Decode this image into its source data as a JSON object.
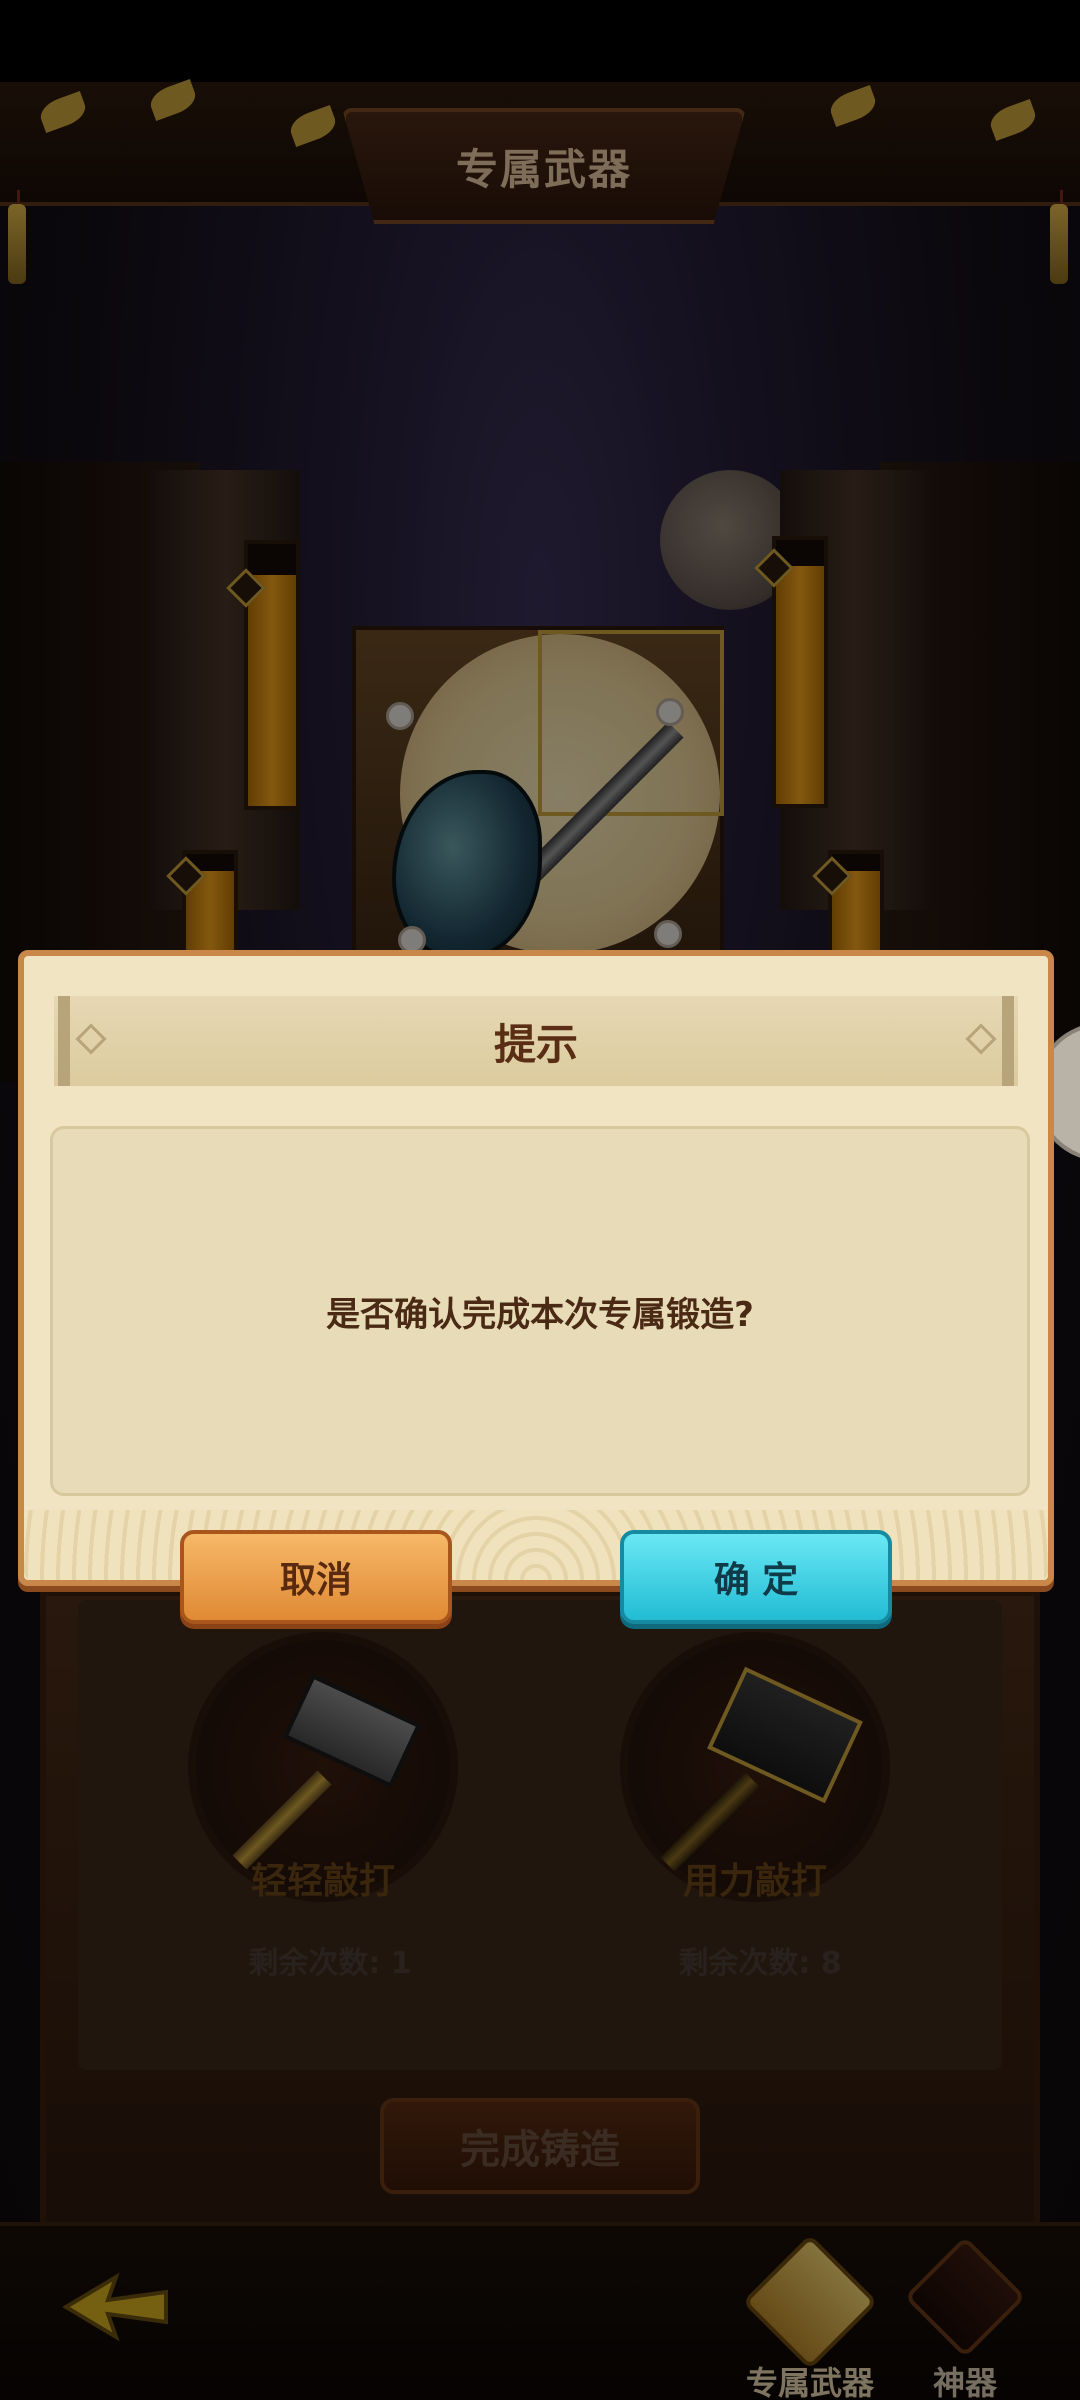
{
  "header": {
    "title": "专属武器"
  },
  "dialog": {
    "title": "提示",
    "message": "是否确认完成本次专属锻造?",
    "cancel_label": "取消",
    "confirm_label": "确 定"
  },
  "forge": {
    "light_hit": {
      "label": "轻轻敲打",
      "remaining": "剩余次数: 1"
    },
    "heavy_hit": {
      "label": "用力敲打",
      "remaining": "剩余次数: 8"
    },
    "complete_label": "完成铸造",
    "gauges": [
      {
        "id": "top-left",
        "fill": 0.88
      },
      {
        "id": "top-right",
        "fill": 0.9
      },
      {
        "id": "bottom-left",
        "fill": 0.85
      },
      {
        "id": "bottom-right",
        "fill": 0.85
      }
    ]
  },
  "bottom_nav": {
    "tabs": [
      {
        "label": "专属武器",
        "icon": "exclusive-weapon-icon",
        "active": true
      },
      {
        "label": "神器",
        "icon": "artifact-icon",
        "active": false
      }
    ]
  },
  "colors": {
    "cancel_button": "#e08a34",
    "confirm_button": "#22bcd4",
    "dialog_bg": "#f0e4c3",
    "gauge_fill": "#f0a01c"
  }
}
